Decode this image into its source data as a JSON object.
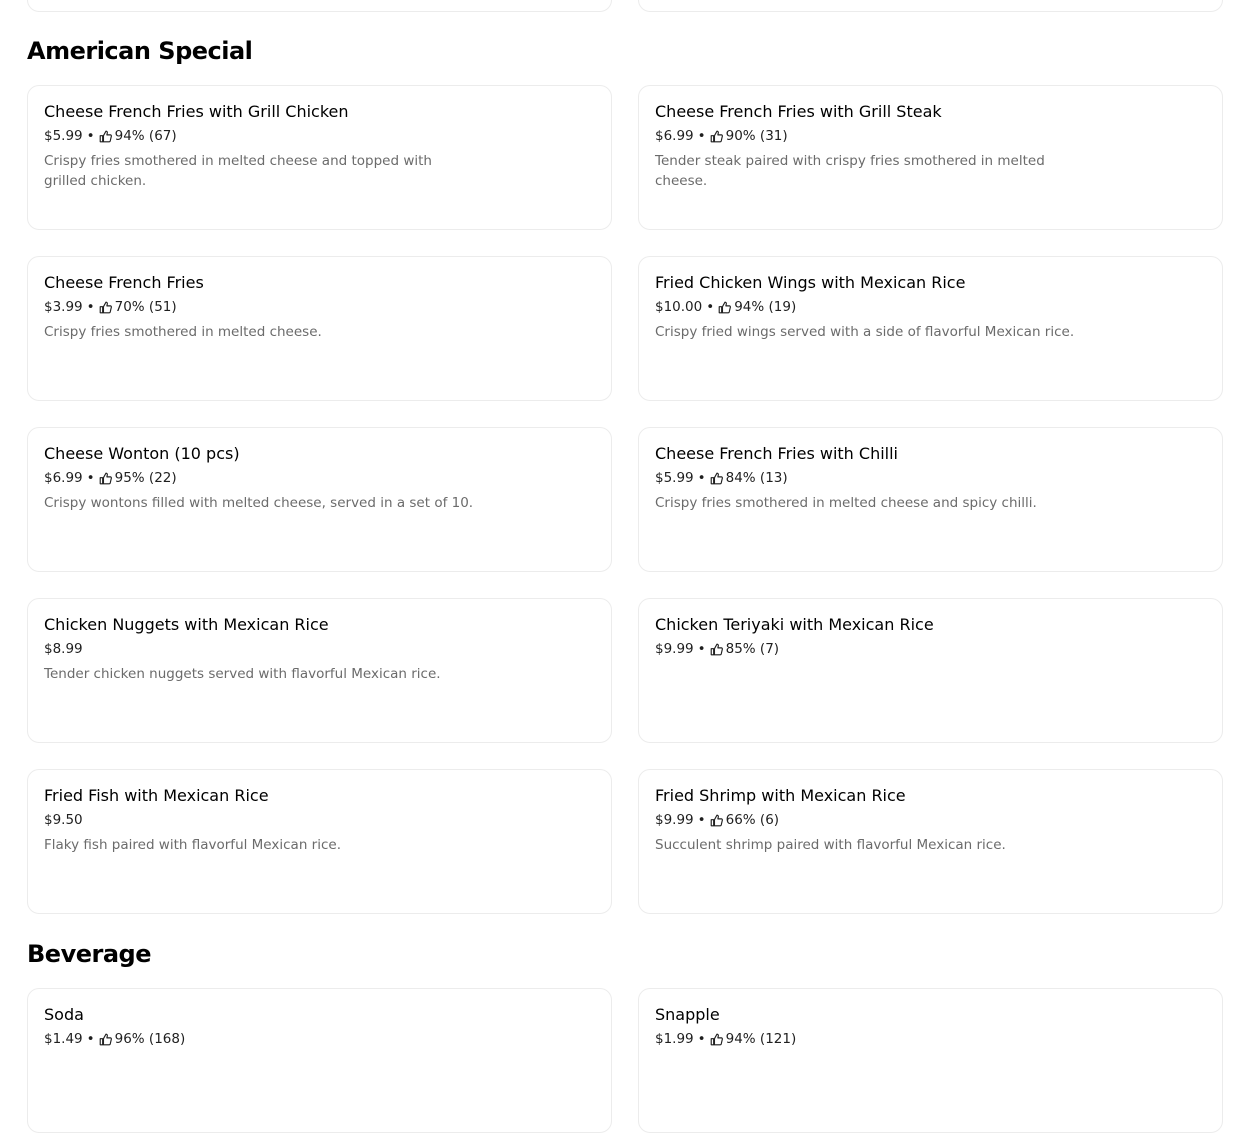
{
  "sections": [
    {
      "title": "American Special",
      "items": [
        {
          "name": "Cheese French Fries with Grill Chicken",
          "price": "$5.99",
          "rating": "94% (67)",
          "desc": "Crispy fries smothered in melted cheese and topped with grilled chicken."
        },
        {
          "name": "Cheese French Fries with Grill Steak",
          "price": "$6.99",
          "rating": "90% (31)",
          "desc": "Tender steak paired with crispy fries smothered in melted cheese."
        },
        {
          "name": "Cheese French Fries",
          "price": "$3.99",
          "rating": "70% (51)",
          "desc": "Crispy fries smothered in melted cheese."
        },
        {
          "name": "Fried Chicken Wings with Mexican Rice",
          "price": "$10.00",
          "rating": "94% (19)",
          "desc": "Crispy fried wings served with a side of flavorful Mexican rice."
        },
        {
          "name": "Cheese Wonton (10 pcs)",
          "price": "$6.99",
          "rating": "95% (22)",
          "desc": "Crispy wontons filled with melted cheese, served in a set of 10."
        },
        {
          "name": "Cheese French Fries with Chilli",
          "price": "$5.99",
          "rating": "84% (13)",
          "desc": "Crispy fries smothered in melted cheese and spicy chilli."
        },
        {
          "name": "Chicken Nuggets with Mexican Rice",
          "price": "$8.99",
          "rating": "",
          "desc": "Tender chicken nuggets served with flavorful Mexican rice."
        },
        {
          "name": "Chicken Teriyaki with Mexican Rice",
          "price": "$9.99",
          "rating": "85% (7)",
          "desc": ""
        },
        {
          "name": "Fried Fish with Mexican Rice",
          "price": "$9.50",
          "rating": "",
          "desc": "Flaky fish paired with flavorful Mexican rice."
        },
        {
          "name": "Fried Shrimp with Mexican Rice",
          "price": "$9.99",
          "rating": "66% (6)",
          "desc": "Succulent shrimp paired with flavorful Mexican rice."
        }
      ]
    },
    {
      "title": "Beverage",
      "items": [
        {
          "name": "Soda",
          "price": "$1.49",
          "rating": "96% (168)",
          "desc": ""
        },
        {
          "name": "Snapple",
          "price": "$1.99",
          "rating": "94% (121)",
          "desc": ""
        }
      ]
    }
  ],
  "separator": "•",
  "icons": {
    "rating": "thumbs-up-icon"
  },
  "colors": {
    "border": "#ececec",
    "desc_text": "#6b6b6b",
    "title_text": "#000000"
  }
}
